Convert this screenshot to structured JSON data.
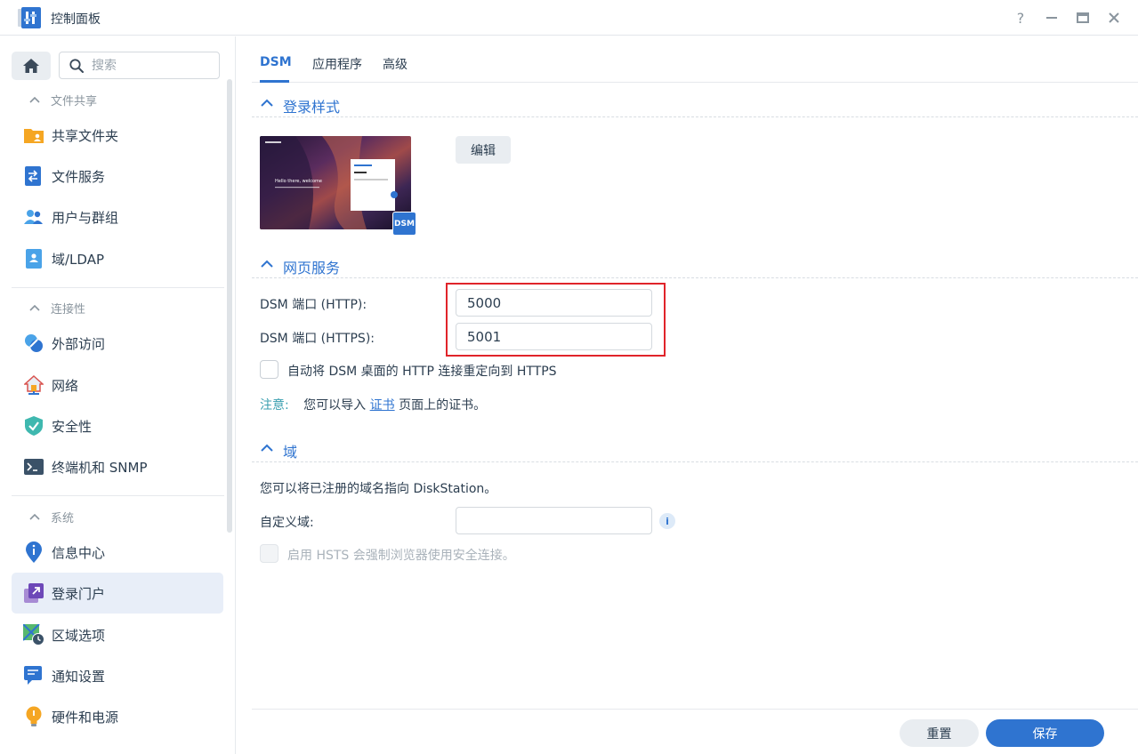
{
  "window": {
    "title": "控制面板",
    "help_glyph": "?"
  },
  "sidebar": {
    "search_placeholder": "搜索",
    "groups": [
      {
        "label": "文件共享",
        "items": [
          {
            "label": "共享文件夹",
            "icon": "shared-folder-icon"
          },
          {
            "label": "文件服务",
            "icon": "file-services-icon"
          },
          {
            "label": "用户与群组",
            "icon": "users-groups-icon"
          },
          {
            "label": "域/LDAP",
            "icon": "domain-ldap-icon"
          }
        ]
      },
      {
        "label": "连接性",
        "items": [
          {
            "label": "外部访问",
            "icon": "external-access-icon"
          },
          {
            "label": "网络",
            "icon": "network-icon"
          },
          {
            "label": "安全性",
            "icon": "security-icon"
          },
          {
            "label": "终端机和 SNMP",
            "icon": "terminal-snmp-icon"
          }
        ]
      },
      {
        "label": "系统",
        "items": [
          {
            "label": "信息中心",
            "icon": "info-center-icon"
          },
          {
            "label": "登录门户",
            "icon": "login-portal-icon",
            "active": true
          },
          {
            "label": "区域选项",
            "icon": "regional-options-icon"
          },
          {
            "label": "通知设置",
            "icon": "notification-icon"
          },
          {
            "label": "硬件和电源",
            "icon": "hardware-power-icon"
          }
        ]
      }
    ]
  },
  "tabs": [
    {
      "label": "DSM",
      "active": true
    },
    {
      "label": "应用程序"
    },
    {
      "label": "高级"
    }
  ],
  "sections": {
    "login_style": {
      "title": "登录样式",
      "edit_label": "编辑",
      "preview_badge": "DSM",
      "preview_welcome": "Hello there, welcome"
    },
    "web_services": {
      "title": "网页服务",
      "http_label": "DSM 端口 (HTTP):",
      "http_value": "5000",
      "https_label": "DSM 端口 (HTTPS):",
      "https_value": "5001",
      "redirect_label": "自动将 DSM 桌面的 HTTP 连接重定向到 HTTPS",
      "note_key": "注意:",
      "note_before": "您可以导入",
      "note_link": "证书",
      "note_after": "页面上的证书。"
    },
    "domain": {
      "title": "域",
      "description": "您可以将已注册的域名指向 DiskStation。",
      "custom_label": "自定义域:",
      "custom_value": "",
      "hsts_label": "启用 HSTS 会强制浏览器使用安全连接。"
    }
  },
  "footer": {
    "reset_label": "重置",
    "save_label": "保存"
  },
  "colors": {
    "accent": "#2f74d0",
    "highlight": "#e0242a"
  }
}
